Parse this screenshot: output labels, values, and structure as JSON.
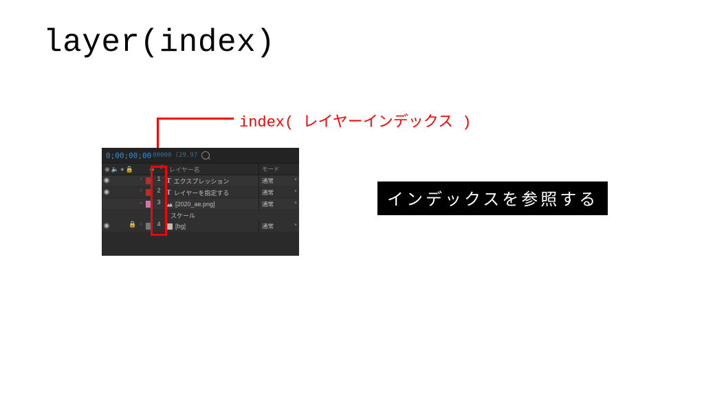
{
  "title": "layer(index)",
  "index_label": "index( レイヤーインデックス )",
  "description": "インデックスを参照する",
  "panel": {
    "timecode": "0;00;00;00",
    "timecode_sub": "00000 (29.97",
    "header": {
      "name_col": "レイヤー名",
      "mode_col": "モード"
    },
    "layers": [
      {
        "idx": "1",
        "name": "エクスプレッション",
        "mode": "通常",
        "type": "text",
        "color": "red",
        "eye": true,
        "lock": false
      },
      {
        "idx": "2",
        "name": "レイヤーを指定する",
        "mode": "通常",
        "type": "text",
        "color": "red",
        "eye": true,
        "lock": false
      },
      {
        "idx": "3",
        "name": "[2020_ae.png]",
        "mode": "通常",
        "type": "image",
        "color": "pink",
        "eye": false,
        "lock": false
      },
      {
        "idx": "4",
        "name": "[bg]",
        "mode": "通常",
        "type": "solid",
        "color": "grey",
        "eye": true,
        "lock": true
      }
    ],
    "sub_property": "スケール"
  }
}
